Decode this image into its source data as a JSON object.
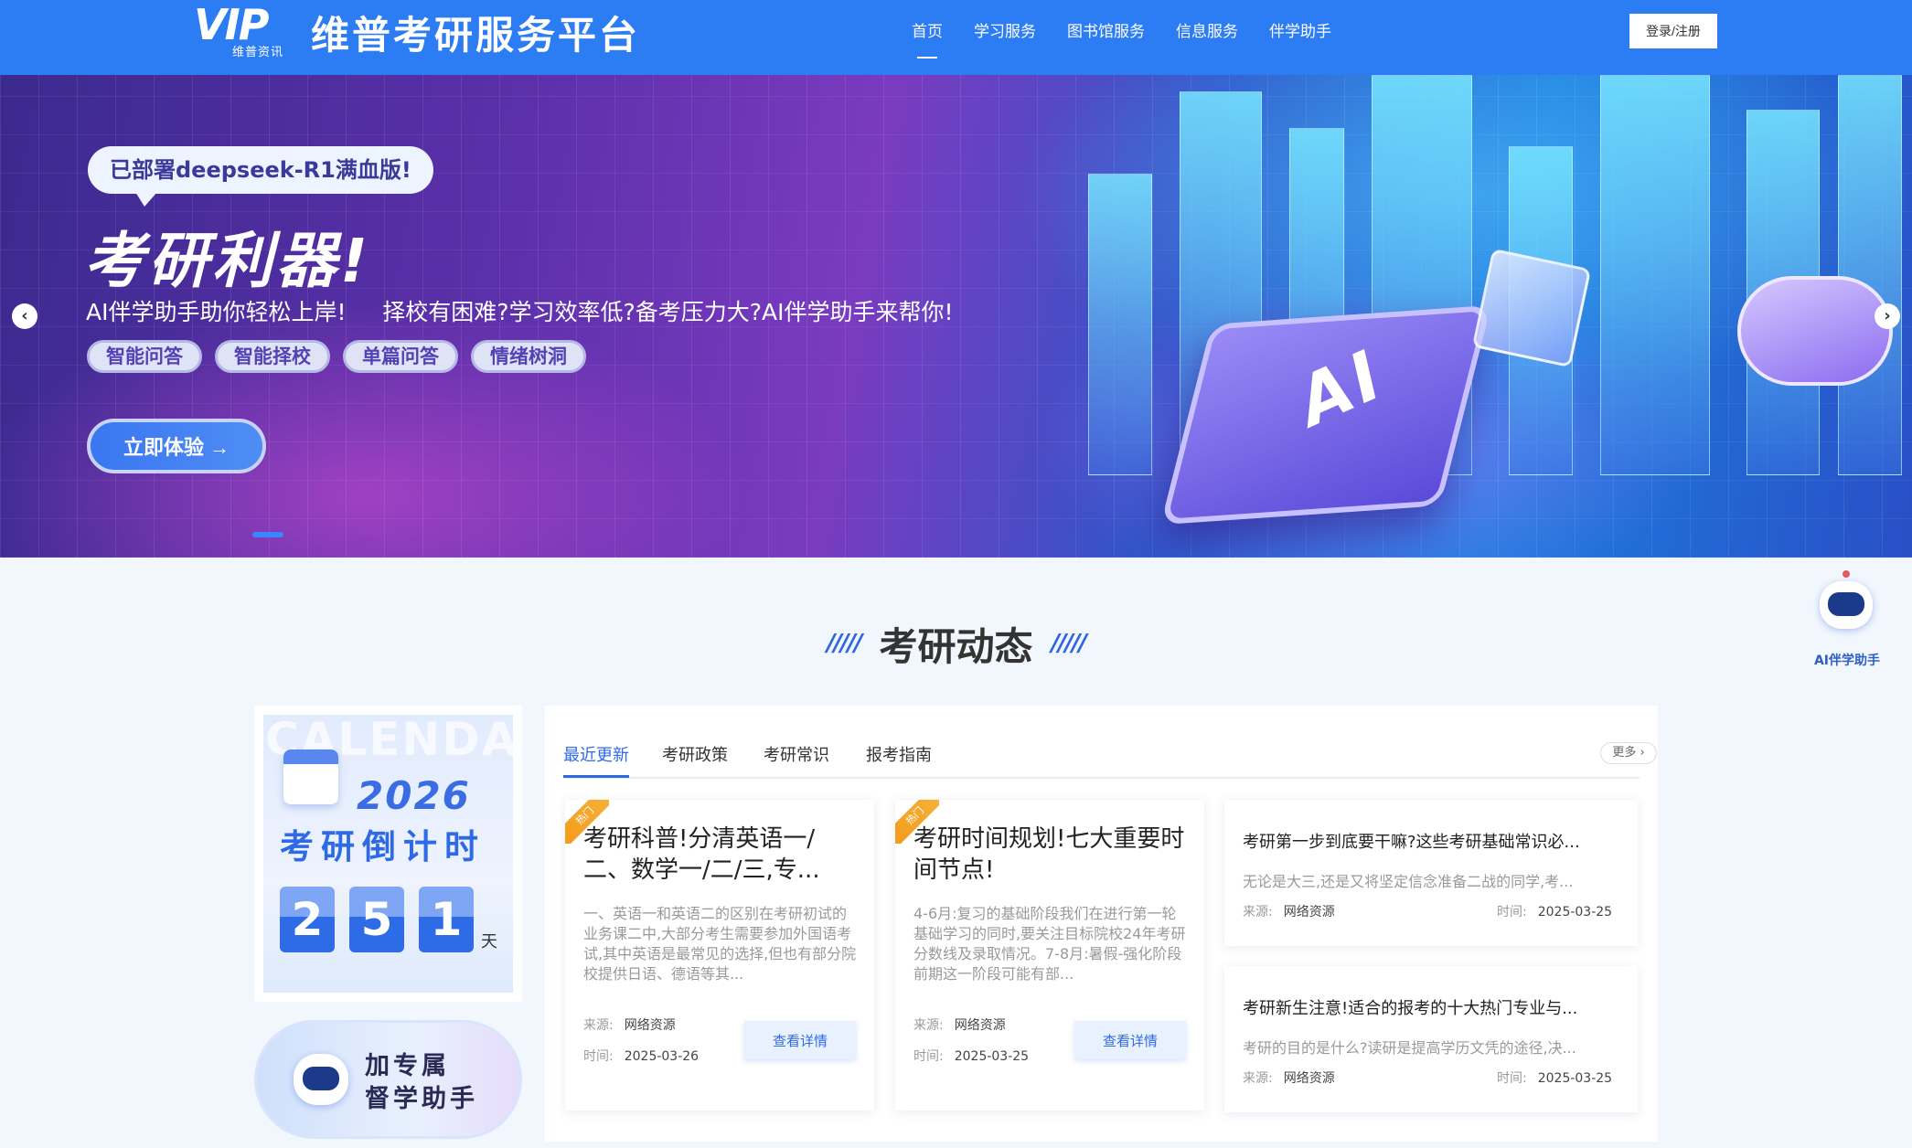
{
  "header": {
    "logo_mark": "VIP",
    "logo_sub": "维普资讯",
    "site_title": "维普考研服务平台",
    "nav": [
      "首页",
      "学习服务",
      "图书馆服务",
      "信息服务",
      "伴学助手"
    ],
    "login_label": "登录/注册"
  },
  "banner": {
    "bubble": "已部署deepseek-R1满血版!",
    "headline": "考研利器!",
    "subline": "AI伴学助手助你轻松上岸!     择校有困难?学习效率低?备考压力大?AI伴学助手来帮你!",
    "pills": [
      "智能问答",
      "智能择校",
      "单篇问答",
      "情绪树洞"
    ],
    "cta": "立即体验 →",
    "chip_label": "AI",
    "arrow_left": "‹",
    "arrow_right": "›"
  },
  "section": {
    "deco_left": "/////",
    "title": "考研动态",
    "deco_right": "/////"
  },
  "countdown": {
    "bg_text": "CALENDAR",
    "year": "2026",
    "title": "考研倒计时",
    "digits": [
      "2",
      "5",
      "1"
    ],
    "unit": "天"
  },
  "assistant_card": {
    "line1": "加专属",
    "line2": "督学助手"
  },
  "news": {
    "tabs": [
      "最近更新",
      "考研政策",
      "考研常识",
      "报考指南"
    ],
    "more": "更多 ›",
    "featured": [
      {
        "badge": "热门",
        "title": "考研科普!分清英语一/二、数学一/二/三,专...",
        "excerpt": "一、英语一和英语二的区别在考研初试的业务课二中,大部分考生需要参加外国语考试,其中英语是最常见的选择,但也有部分院校提供日语、德语等其...",
        "source_label": "来源:",
        "source": "网络资源",
        "time_label": "时间:",
        "time": "2025-03-26",
        "button": "查看详情"
      },
      {
        "badge": "热门",
        "title": "考研时间规划!七大重要时间节点!",
        "excerpt": "4-6月:复习的基础阶段我们在进行第一轮基础学习的同时,要关注目标院校24年考研分数线及录取情况。7-8月:暑假-强化阶段前期这一阶段可能有部...",
        "source_label": "来源:",
        "source": "网络资源",
        "time_label": "时间:",
        "time": "2025-03-25",
        "button": "查看详情"
      }
    ],
    "list": [
      {
        "title": "考研第一步到底要干嘛?这些考研基础常识必...",
        "excerpt": "无论是大三,还是又将坚定信念准备二战的同学,考...",
        "source_label": "来源:",
        "source": "网络资源",
        "time_label": "时间:",
        "time": "2025-03-25"
      },
      {
        "title": "考研新生注意!适合的报考的十大热门专业与...",
        "excerpt": "考研的目的是什么?读研是提高学历文凭的途径,决...",
        "source_label": "来源:",
        "source": "网络资源",
        "time_label": "时间:",
        "time": "2025-03-25"
      }
    ]
  },
  "float_ai": {
    "label": "AI伴学助手"
  },
  "colors": {
    "brand": "#2c7cf3",
    "accent": "#2f6ae6",
    "hot_badge": "#f29a1b"
  }
}
